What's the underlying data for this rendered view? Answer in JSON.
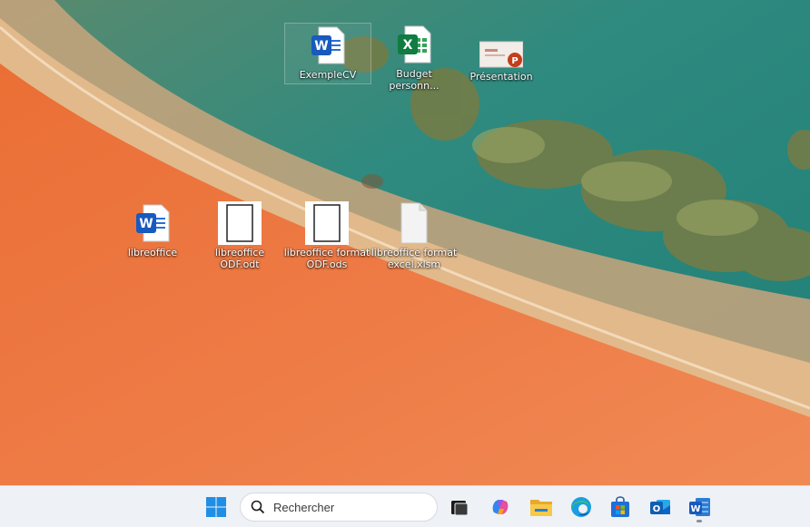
{
  "desktop": {
    "icons": [
      {
        "label": "ExempleCV"
      },
      {
        "label": "Budget personn..."
      },
      {
        "label": "Présentation"
      },
      {
        "label": "libreoffice"
      },
      {
        "label": "libreoffice ODF.odt"
      },
      {
        "label": "libreoffice format ODF.ods"
      },
      {
        "label": "libreoffice format excel.xlsm"
      }
    ]
  },
  "taskbar": {
    "search_placeholder": "Rechercher",
    "buttons": [
      "start",
      "search",
      "task-view",
      "copilot",
      "file-explorer",
      "edge",
      "microsoft-store",
      "outlook",
      "word"
    ]
  },
  "colors": {
    "sea": "#2e8a80",
    "sand": "#e1a877",
    "shore": "#e36a34",
    "taskbar": "#eef1f6",
    "word_blue": "#185abd",
    "excel_green": "#107c41",
    "powerpoint_red": "#c43e1c"
  }
}
